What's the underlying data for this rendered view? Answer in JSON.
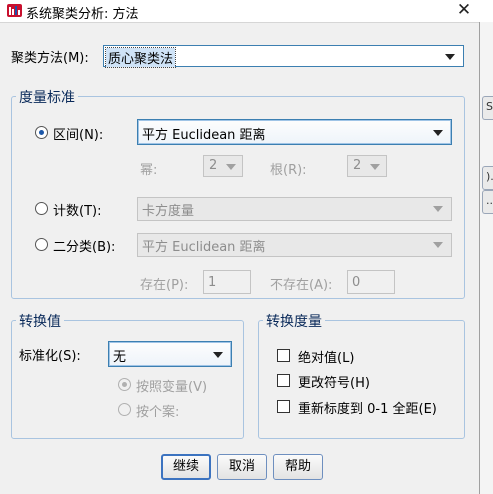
{
  "window": {
    "title": "系统聚类分析: 方法",
    "close_glyph": "✕"
  },
  "cluster_method": {
    "label": "聚类方法(M):",
    "value": "质心聚类法"
  },
  "measure_group": {
    "title": "度量标准",
    "interval": {
      "label": "区间(N):",
      "value": "平方 Euclidean 距离",
      "checked": true,
      "power_label": "幂:",
      "power_value": "2",
      "root_label": "根(R):",
      "root_value": "2"
    },
    "counts": {
      "label": "计数(T):",
      "value": "卡方度量",
      "checked": false
    },
    "binary": {
      "label": "二分类(B):",
      "value": "平方 Euclidean 距离",
      "checked": false,
      "present_label": "存在(P):",
      "present_value": "1",
      "absent_label": "不存在(A):",
      "absent_value": "0"
    }
  },
  "transform_values": {
    "title": "转换值",
    "standardize_label": "标准化(S):",
    "standardize_value": "无",
    "by_variable": "按照变量(V)",
    "by_case": "按个案:"
  },
  "transform_measures": {
    "title": "转换度量",
    "absolute": "绝对值(L)",
    "change_sign": "更改符号(H)",
    "rescale": "重新标度到 0-1 全距(E)"
  },
  "buttons": {
    "continue": "继续",
    "cancel": "取消",
    "help": "帮助"
  },
  "background_window": {
    "glyph_1": "S)",
    "glyph_2": ")...",
    "glyph_3": "..."
  },
  "colors": {
    "group_border": "#a9c4e0",
    "group_title": "#0a2a5a",
    "accent": "#3c73c0"
  }
}
